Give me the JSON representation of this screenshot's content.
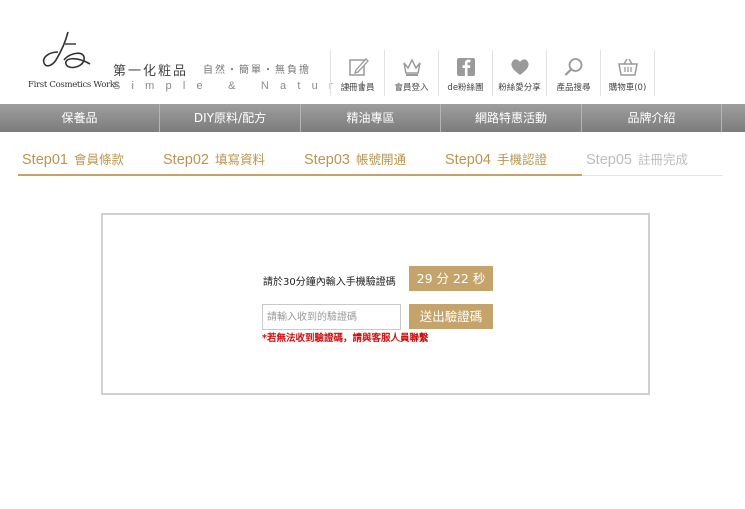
{
  "header": {
    "logo_text": "First Cosmetics Works",
    "brand_cn": "第一化粧品",
    "slogan_cn": "自然・簡單・無負擔",
    "slogan_en": "Simple & Natural",
    "utility_nav": [
      {
        "label": "註冊會員",
        "icon": "edit-icon"
      },
      {
        "label": "會員登入",
        "icon": "crown-icon"
      },
      {
        "label": "de粉絲團",
        "icon": "facebook-icon"
      },
      {
        "label": "粉絲愛分享",
        "icon": "heart-icon"
      },
      {
        "label": "產品搜尋",
        "icon": "search-icon"
      },
      {
        "label": "購物車(0)",
        "icon": "cart-icon"
      }
    ]
  },
  "main_nav": [
    {
      "label": "保養品"
    },
    {
      "label": "DIY原料/配方"
    },
    {
      "label": "精油專區"
    },
    {
      "label": "網路特惠活動"
    },
    {
      "label": "品牌介紹"
    }
  ],
  "steps": [
    {
      "num": "Step01",
      "label": "會員條款",
      "status": "done"
    },
    {
      "num": "Step02",
      "label": "填寫資料",
      "status": "done"
    },
    {
      "num": "Step03",
      "label": "帳號開通",
      "status": "done"
    },
    {
      "num": "Step04",
      "label": "手機認證",
      "status": "current"
    },
    {
      "num": "Step05",
      "label": "註冊完成",
      "status": "todo"
    }
  ],
  "verify": {
    "prompt": "請於30分鐘內輸入手機驗證碼",
    "timer": "29 分 22 秒",
    "code_placeholder": "請輸入收到的驗證碼",
    "code_value": "",
    "send_label": "送出驗證碼",
    "note": "*若無法收到驗證碼，請與客服人員聯繫"
  },
  "colors": {
    "accent_gold": "#c4a46a",
    "step_done": "#b99650",
    "step_todo": "#bdbdbd",
    "nav_bg": "#8c8c8c",
    "note_red": "#d01010"
  }
}
